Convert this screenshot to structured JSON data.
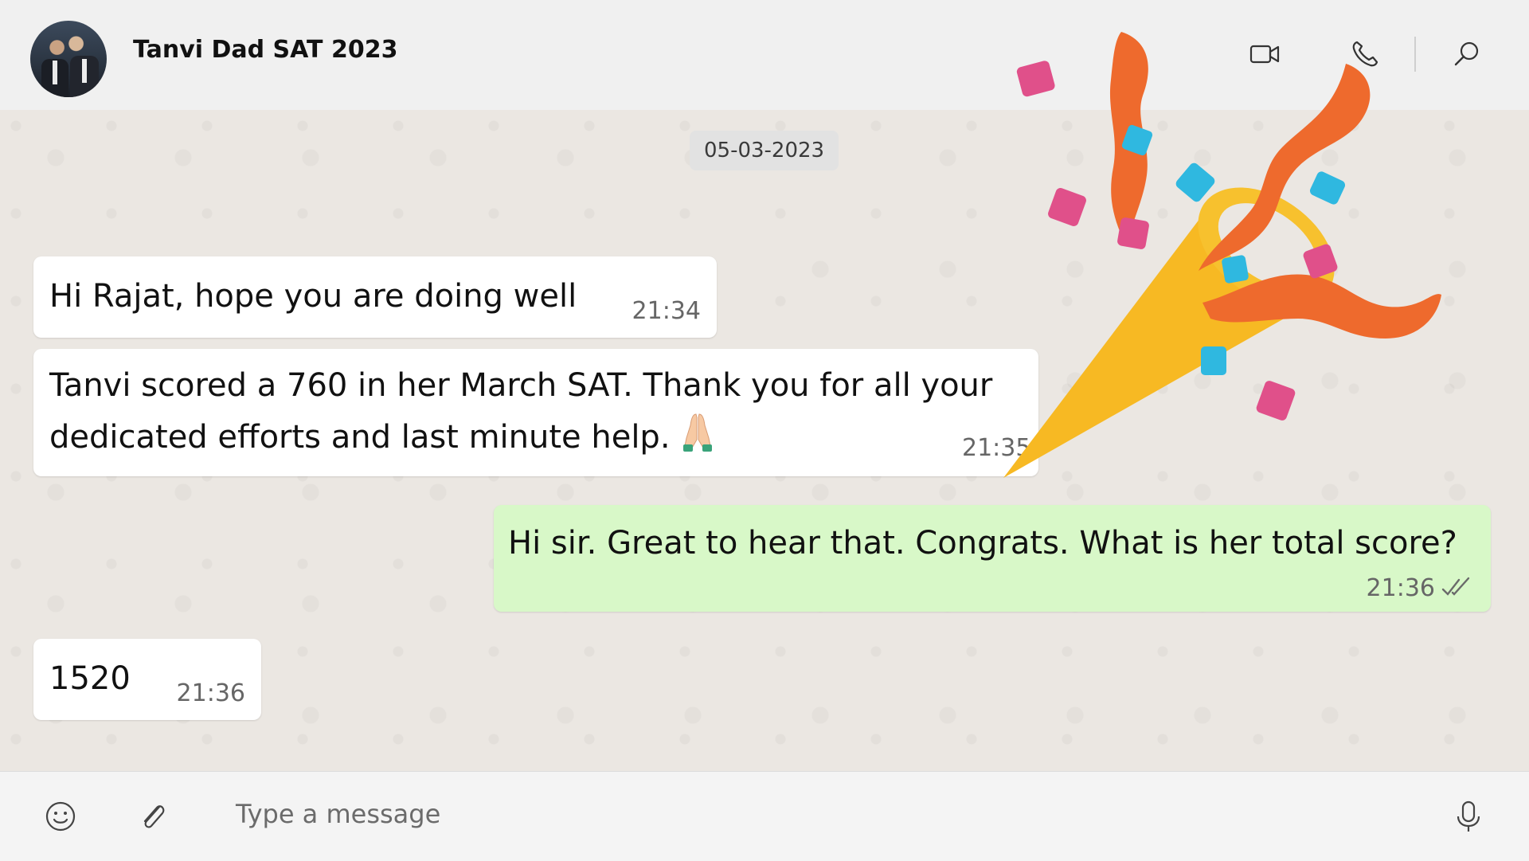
{
  "header": {
    "contact_name": "Tanvi Dad SAT 2023",
    "icons": [
      "avatar",
      "video-call-icon",
      "voice-call-icon",
      "search-icon"
    ]
  },
  "chat": {
    "date_chip": "05-03-2023",
    "messages": [
      {
        "direction": "in",
        "text": "Hi Rajat, hope you are doing well",
        "time": "21:34"
      },
      {
        "direction": "in",
        "text": "Tanvi scored a 760 in her March SAT. Thank you for all your dedicated efforts and last minute help.",
        "emoji": "folded-hands",
        "time": "21:35"
      },
      {
        "direction": "out",
        "text": "Hi sir. Great to hear that. Congrats. What is her total score?",
        "time": "21:36",
        "status": "read-double-tick"
      },
      {
        "direction": "in",
        "text": "1520",
        "time": "21:36"
      }
    ],
    "overlay_sticker": "party-popper"
  },
  "composer": {
    "placeholder": "Type a message",
    "icons": [
      "emoji-icon",
      "attach-icon",
      "microphone-icon"
    ]
  },
  "colors": {
    "incoming_bubble": "#ffffff",
    "outgoing_bubble": "#d8f8c8",
    "chat_background": "#ebe7e2"
  }
}
